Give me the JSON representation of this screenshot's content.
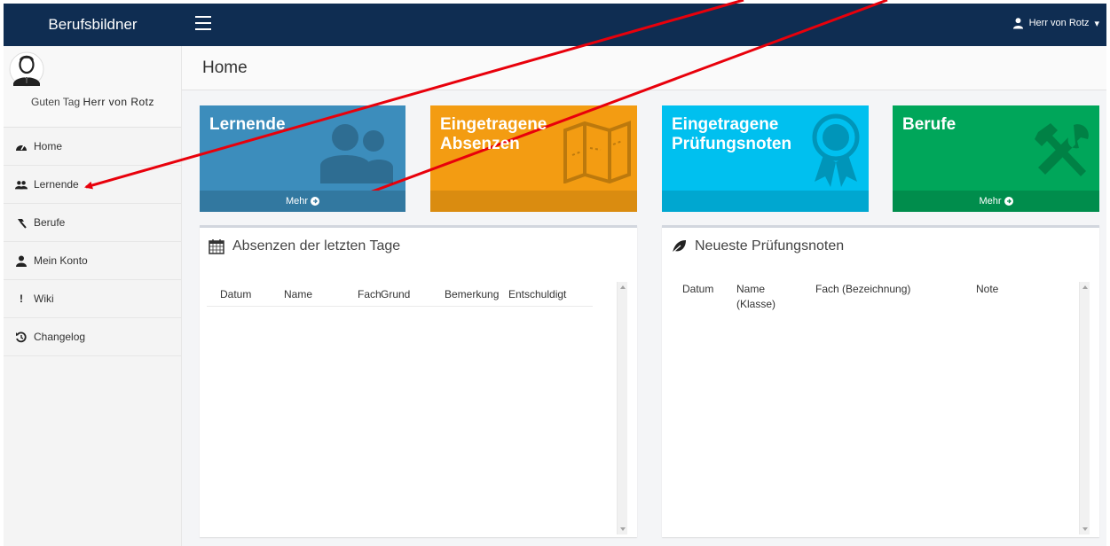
{
  "app": {
    "brand": "Berufsbildner"
  },
  "topbar": {
    "user_name": "Herr von Rotz"
  },
  "sidebar": {
    "greeting_prefix": "Guten Tag",
    "greeting_name": "Herr von Rotz",
    "items": [
      {
        "label": "Home",
        "icon": "dashboard-icon"
      },
      {
        "label": "Lernende",
        "icon": "users-icon"
      },
      {
        "label": "Berufe",
        "icon": "gavel-icon"
      },
      {
        "label": "Mein Konto",
        "icon": "user-icon"
      },
      {
        "label": "Wiki",
        "icon": "exclamation-icon"
      },
      {
        "label": "Changelog",
        "icon": "history-icon"
      }
    ]
  },
  "page": {
    "title": "Home"
  },
  "boxes": [
    {
      "label": "Lernende",
      "footer": "Mehr",
      "color": "#3c8dbc"
    },
    {
      "label": "Eingetragene Absenzen",
      "footer": "",
      "color": "#f39c12"
    },
    {
      "label": "Eingetragene Prüfungsnoten",
      "footer": "",
      "color": "#00c0ef"
    },
    {
      "label": "Berufe",
      "footer": "Mehr",
      "color": "#00a65a"
    }
  ],
  "absenzen_panel": {
    "title": "Absenzen der letzten Tage",
    "columns": [
      "Datum",
      "Name",
      "Fach",
      "Grund",
      "Bemerkung",
      "Entschuldigt"
    ]
  },
  "pruefungen_panel": {
    "title": "Neueste Prüfungsnoten",
    "columns": [
      "Datum",
      "Name (Klasse)",
      "Fach (Bezeichnung)",
      "Note"
    ]
  },
  "colors": {
    "navbar": "#0f2d52",
    "annotation_arrow": "#e8000b"
  }
}
